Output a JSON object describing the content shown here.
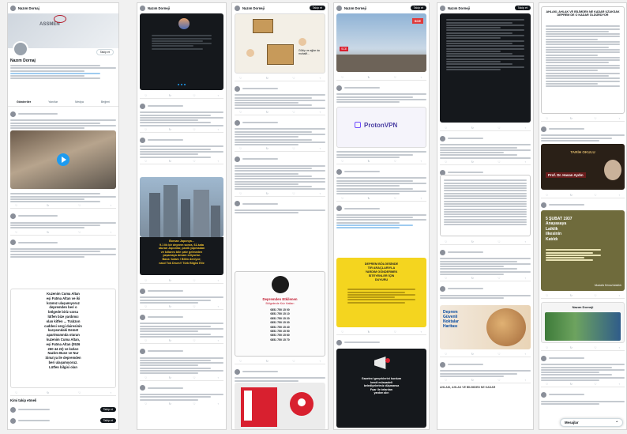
{
  "col1": {
    "name": "Nazım Dornaj",
    "banner": "ASSMEN",
    "follow": "Takip et",
    "tabs": [
      "Gönderiler",
      "Yanıtlar",
      "Medya",
      "Beğeni"
    ],
    "quote_lines": [
      "Kuzenim Cuma Altan",
      "eşi Fatma Altan ve iki",
      "kızımız ulaşamıyoruz",
      "depremden beri o",
      "bölgede biriz varsa",
      "lütfen bize yardımcı",
      "olan kitfen ... Trabzon",
      "caddesi vergi dairesinin",
      "karşısındaki Demet",
      "apartmanında oturan",
      "kuzenim Cuma Altan,",
      "eşi Fatma Altan (0536",
      "260 44 22) ve kızları",
      "Nazlım Buse ve Nur",
      "Sima'ya ile depremden",
      "beri ulaşamıyoruz.",
      "Lütfen bilgisi olan"
    ],
    "who_to_follow": "Kimi takip etmeli"
  },
  "col2": {
    "name": "Nazım Dorneji",
    "caption": [
      "Borsan Japonya...",
      "9.1 lik bir deprem sonra, 61.kata",
      "oturan Japonlar, panik yapmadan",
      "ve kıllarını bile çatır gelmeden",
      "yaşamaya devam ediyorlar.",
      "Bana 'Adam ! Bilim deniyor;",
      "nasıl Tok Drum!! Türk Bilgisi Elle"
    ]
  },
  "col3": {
    "name": "Nazım Dorneji",
    "cartoon_label": "Gülüp ve ağlar da muhalif...",
    "poster_title": "Depremden Etkilenen",
    "poster_sub": "Bölgelerde Kriz Hatları",
    "poster_phones": [
      "0851 750 15 00",
      "0851 750 15 10",
      "0851 750 15 20",
      "0851 750 15 30",
      "0851 750 15 40",
      "0851 750 15 50",
      "0851 750 15 60",
      "0851 750 15 70"
    ]
  },
  "col4": {
    "name": "Nazım Dorneji",
    "vpn": "ProtonVPN",
    "yellow_lines": [
      "DEPREM BÖLGESİNDE",
      "TIR ARAÇLARIYLA",
      "YARDIM GÖNDERMEK",
      "İSTEYENLER İÇİN",
      "DUYURU"
    ],
    "dark_lines": [
      "Gazeteci gerçeklerini kurdum",
      "kendi müsaadeli",
      "belediyelerimiz düşmansa",
      "Fuar ile tırlardan",
      "yardım alın"
    ]
  },
  "col5": {
    "name": "Nazım Dorneji",
    "map_title": [
      "Deprem",
      "Güvenli",
      "Noktalar",
      "Haritası"
    ],
    "bottom_line": "AHLAKI, AHLAK VE BİLİMDEN NE KADAR"
  },
  "col6": {
    "doc_title": "AHLAKI, AHLAK VE BİLİMDEN NE KADAR UZAKSAK DEPREM DE O KADAR ÖLDÜRÜYOR",
    "event_label": "TARİH OKULU",
    "speaker": "Prof. Dr. Hasan Aydın",
    "green_lines": [
      "5 ŞUBAT 1937",
      "Anayasaya",
      "Laiklik",
      "ilkesinin",
      "Katıldı"
    ],
    "quote": "Mustafa Kemal Atatürk",
    "bottom_name": "Nazım Dorneji",
    "messages": "Mesajlar"
  },
  "colors": {
    "accent": "#1d9bf0",
    "dark": "#15181c",
    "yellow": "#f4d51f"
  }
}
